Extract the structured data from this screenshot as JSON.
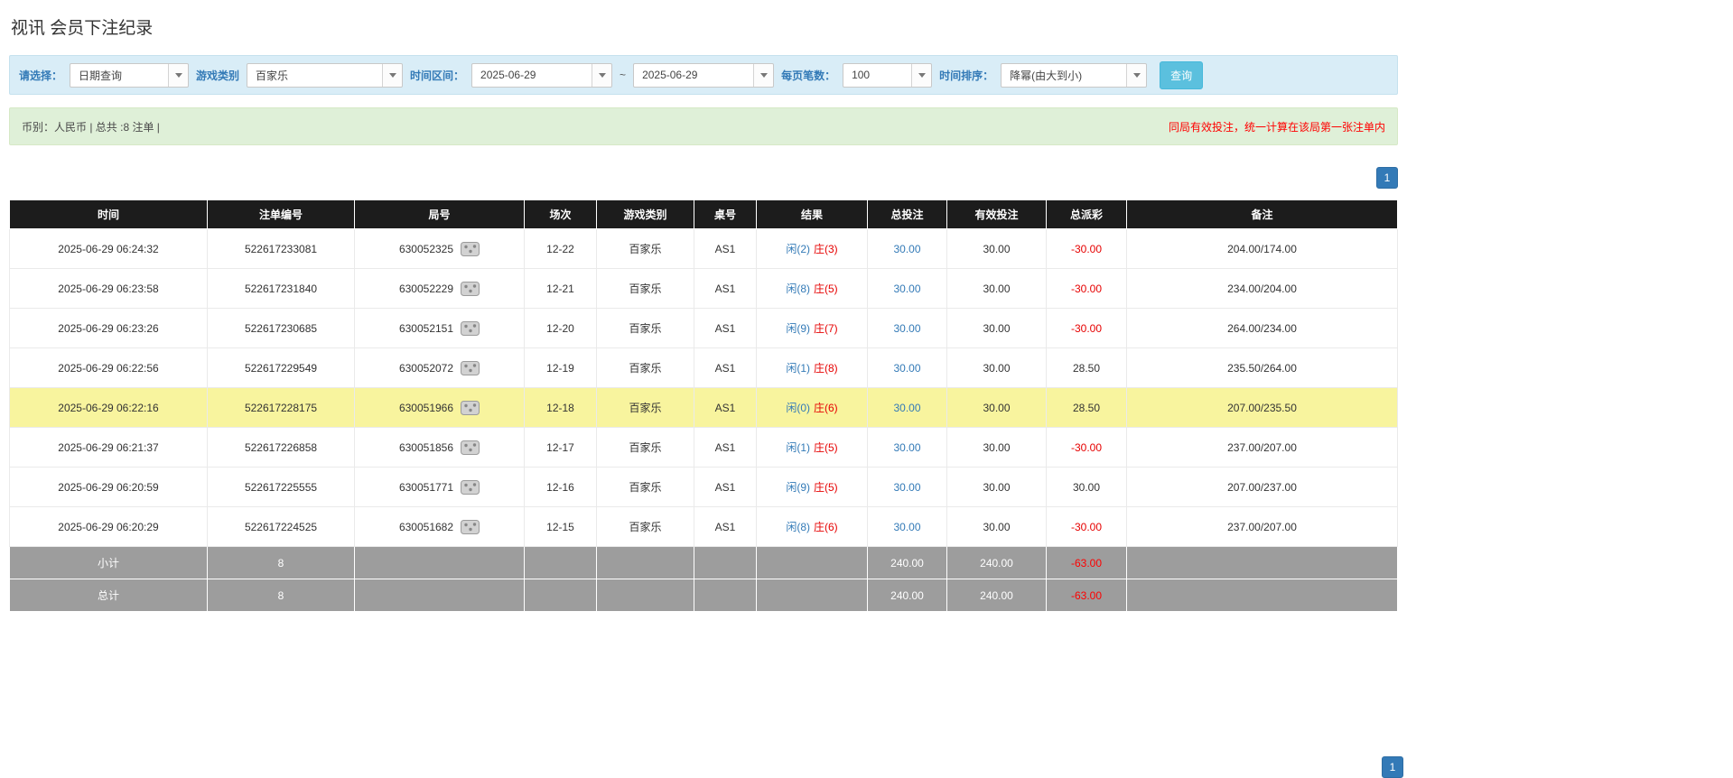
{
  "page_title": "视讯 会员下注纪录",
  "filters": {
    "select_label": "请选择：",
    "select_value": "日期查询",
    "game_type_label": "游戏类别",
    "game_type_value": "百家乐",
    "time_range_label": "时间区间：",
    "date_from": "2025-06-29",
    "date_separator": "~",
    "date_to": "2025-06-29",
    "per_page_label": "每页笔数：",
    "per_page_value": "100",
    "sort_label": "时间排序：",
    "sort_value": "降幂(由大到小)",
    "search_button": "查询"
  },
  "info_bar": {
    "summary": "币别：人民币 | 总共 :8 注单 |",
    "notice": "同局有效投注，统一计算在该局第一张注单内"
  },
  "pagination": {
    "current_page": "1"
  },
  "colors": {
    "accent_blue": "#337ab7",
    "player_blue": "#337ab7",
    "banker_red": "#e60000",
    "negative_red": "#e60000",
    "highlight_yellow": "#f8f49e",
    "header_black": "#1c1c1c",
    "footer_gray": "#9d9d9d"
  },
  "table": {
    "headers": [
      "时间",
      "注单编号",
      "局号",
      "场次",
      "游戏类别",
      "桌号",
      "结果",
      "总投注",
      "有效投注",
      "总派彩",
      "备注"
    ],
    "icons": {
      "round_detail": "dice-icon"
    },
    "rows": [
      {
        "time": "2025-06-29 06:24:32",
        "bet_no": "522617233081",
        "round_no": "630052325",
        "session": "12-22",
        "game": "百家乐",
        "table_no": "AS1",
        "result_player": "闲(2)",
        "result_banker": "庄(3)",
        "total_bet": "30.00",
        "valid_bet": "30.00",
        "payout": "-30.00",
        "payout_red": true,
        "remark": "204.00/174.00",
        "highlight": false
      },
      {
        "time": "2025-06-29 06:23:58",
        "bet_no": "522617231840",
        "round_no": "630052229",
        "session": "12-21",
        "game": "百家乐",
        "table_no": "AS1",
        "result_player": "闲(8)",
        "result_banker": "庄(5)",
        "total_bet": "30.00",
        "valid_bet": "30.00",
        "payout": "-30.00",
        "payout_red": true,
        "remark": "234.00/204.00",
        "highlight": false
      },
      {
        "time": "2025-06-29 06:23:26",
        "bet_no": "522617230685",
        "round_no": "630052151",
        "session": "12-20",
        "game": "百家乐",
        "table_no": "AS1",
        "result_player": "闲(9)",
        "result_banker": "庄(7)",
        "total_bet": "30.00",
        "valid_bet": "30.00",
        "payout": "-30.00",
        "payout_red": true,
        "remark": "264.00/234.00",
        "highlight": false
      },
      {
        "time": "2025-06-29 06:22:56",
        "bet_no": "522617229549",
        "round_no": "630052072",
        "session": "12-19",
        "game": "百家乐",
        "table_no": "AS1",
        "result_player": "闲(1)",
        "result_banker": "庄(8)",
        "total_bet": "30.00",
        "valid_bet": "30.00",
        "payout": "28.50",
        "payout_red": false,
        "remark": "235.50/264.00",
        "highlight": false
      },
      {
        "time": "2025-06-29 06:22:16",
        "bet_no": "522617228175",
        "round_no": "630051966",
        "session": "12-18",
        "game": "百家乐",
        "table_no": "AS1",
        "result_player": "闲(0)",
        "result_banker": "庄(6)",
        "total_bet": "30.00",
        "valid_bet": "30.00",
        "payout": "28.50",
        "payout_red": false,
        "remark": "207.00/235.50",
        "highlight": true
      },
      {
        "time": "2025-06-29 06:21:37",
        "bet_no": "522617226858",
        "round_no": "630051856",
        "session": "12-17",
        "game": "百家乐",
        "table_no": "AS1",
        "result_player": "闲(1)",
        "result_banker": "庄(5)",
        "total_bet": "30.00",
        "valid_bet": "30.00",
        "payout": "-30.00",
        "payout_red": true,
        "remark": "237.00/207.00",
        "highlight": false
      },
      {
        "time": "2025-06-29 06:20:59",
        "bet_no": "522617225555",
        "round_no": "630051771",
        "session": "12-16",
        "game": "百家乐",
        "table_no": "AS1",
        "result_player": "闲(9)",
        "result_banker": "庄(5)",
        "total_bet": "30.00",
        "valid_bet": "30.00",
        "payout": "30.00",
        "payout_red": false,
        "remark": "207.00/237.00",
        "highlight": false
      },
      {
        "time": "2025-06-29 06:20:29",
        "bet_no": "522617224525",
        "round_no": "630051682",
        "session": "12-15",
        "game": "百家乐",
        "table_no": "AS1",
        "result_player": "闲(8)",
        "result_banker": "庄(6)",
        "total_bet": "30.00",
        "valid_bet": "30.00",
        "payout": "-30.00",
        "payout_red": true,
        "remark": "237.00/207.00",
        "highlight": false
      }
    ],
    "subtotal": {
      "label": "小计",
      "count": "8",
      "total_bet": "240.00",
      "valid_bet": "240.00",
      "payout": "-63.00"
    },
    "total": {
      "label": "总计",
      "count": "8",
      "total_bet": "240.00",
      "valid_bet": "240.00",
      "payout": "-63.00"
    }
  }
}
